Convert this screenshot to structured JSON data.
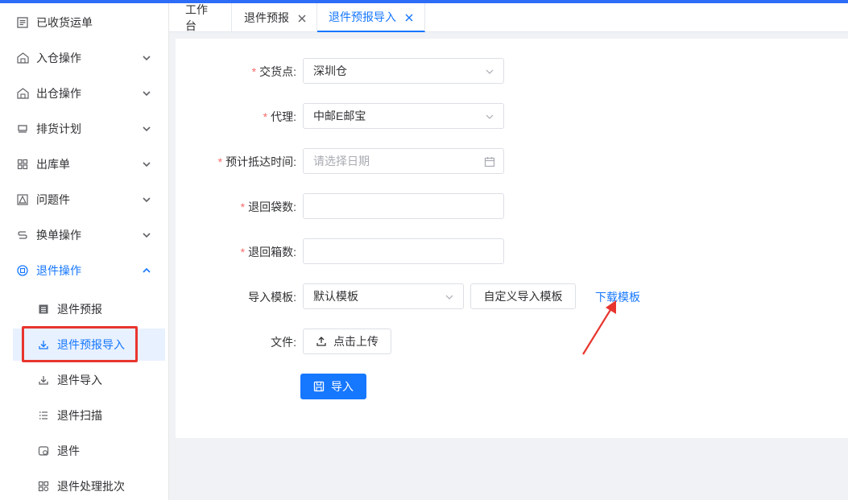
{
  "sidebar": {
    "items": [
      {
        "label": "已收货运单",
        "icon": "document-list-icon"
      },
      {
        "label": "入仓操作",
        "icon": "warehouse-in-icon"
      },
      {
        "label": "出仓操作",
        "icon": "warehouse-out-icon"
      },
      {
        "label": "排货计划",
        "icon": "truck-icon"
      },
      {
        "label": "出库单",
        "icon": "grid-icon"
      },
      {
        "label": "问题件",
        "icon": "warning-icon"
      },
      {
        "label": "换单操作",
        "icon": "swap-icon"
      },
      {
        "label": "退件操作",
        "icon": "return-icon"
      }
    ],
    "sub_items": [
      {
        "label": "退件预报",
        "icon": "list-icon"
      },
      {
        "label": "退件预报导入",
        "icon": "download-icon"
      },
      {
        "label": "退件导入",
        "icon": "download-icon"
      },
      {
        "label": "退件扫描",
        "icon": "scan-list-icon"
      },
      {
        "label": "退件",
        "icon": "package-icon"
      },
      {
        "label": "退件处理批次",
        "icon": "batch-grid-icon"
      }
    ]
  },
  "tabs": [
    {
      "label": "工作台"
    },
    {
      "label": "退件预报"
    },
    {
      "label": "退件预报导入"
    }
  ],
  "form": {
    "delivery_point": {
      "label": "交货点:",
      "value": "深圳仓"
    },
    "agent": {
      "label": "代理:",
      "value": "中邮E邮宝"
    },
    "arrival_time": {
      "label": "预计抵达时间:",
      "placeholder": "请选择日期"
    },
    "bags": {
      "label": "退回袋数:",
      "value": ""
    },
    "boxes": {
      "label": "退回箱数:",
      "value": ""
    },
    "template": {
      "label": "导入模板:",
      "value": "默认模板"
    },
    "custom_template_button": "自定义导入模板",
    "download_template_link": "下载模板",
    "file": {
      "label": "文件:",
      "upload_button": "点击上传"
    },
    "import_button": "导入",
    "required_mark": "*"
  },
  "colors": {
    "accent": "#1677ff",
    "topbar": "#2d6cf6",
    "required": "#f56c6c",
    "annotation": "#e8352e"
  }
}
